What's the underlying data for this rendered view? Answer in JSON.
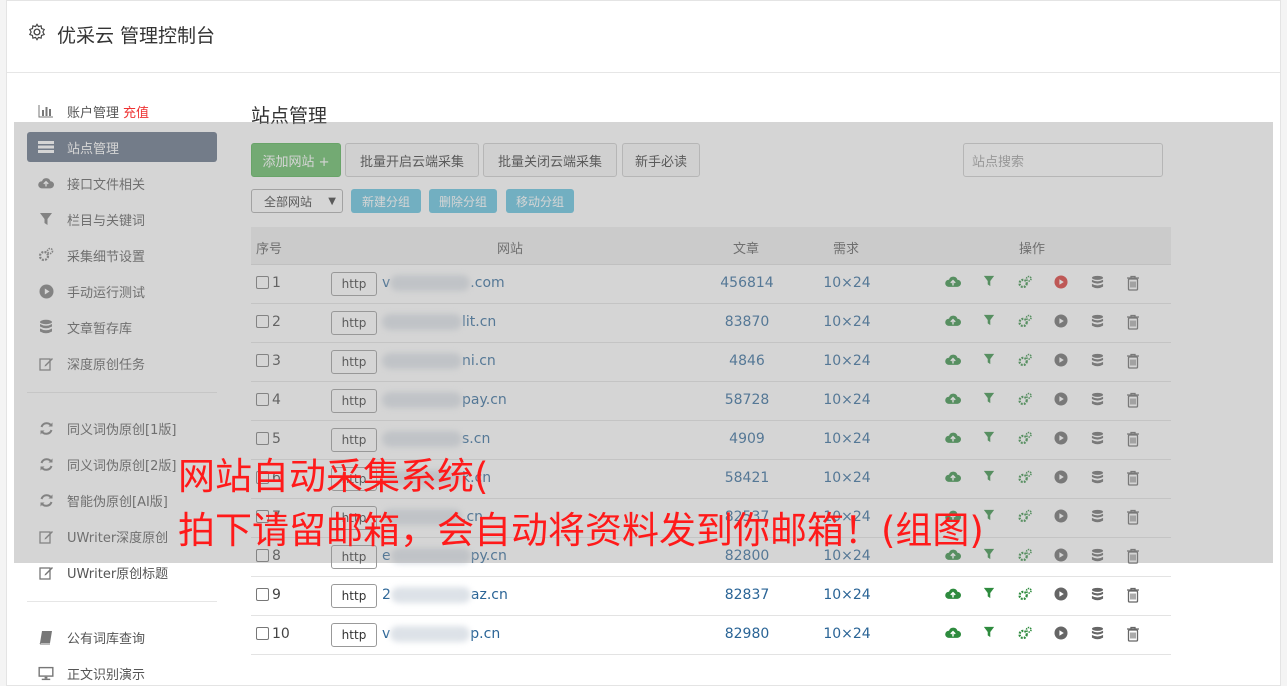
{
  "app": {
    "title": "优采云 管理控制台"
  },
  "sidebar": {
    "group1": [
      {
        "label": "账户管理",
        "tag": "充值",
        "icon": "bar-chart-icon",
        "active": false
      },
      {
        "label": "站点管理",
        "tag": "",
        "icon": "list-icon",
        "active": true
      },
      {
        "label": "接口文件相关",
        "tag": "",
        "icon": "cloud-upload-icon",
        "active": false
      },
      {
        "label": "栏目与关键词",
        "tag": "",
        "icon": "filter-icon",
        "active": false
      },
      {
        "label": "采集细节设置",
        "tag": "",
        "icon": "cogs-icon",
        "active": false
      },
      {
        "label": "手动运行测试",
        "tag": "",
        "icon": "play-circle-icon",
        "active": false
      },
      {
        "label": "文章暂存库",
        "tag": "",
        "icon": "database-icon",
        "active": false
      },
      {
        "label": "深度原创任务",
        "tag": "",
        "icon": "edit-icon",
        "active": false
      }
    ],
    "group2": [
      {
        "label": "同义词伪原创[1版]",
        "icon": "refresh-icon"
      },
      {
        "label": "同义词伪原创[2版]",
        "icon": "refresh-icon"
      },
      {
        "label": "智能伪原创[AI版]",
        "icon": "refresh-icon"
      },
      {
        "label": "UWriter深度原创",
        "icon": "edit-icon"
      },
      {
        "label": "UWriter原创标题",
        "icon": "edit-icon"
      }
    ],
    "group3": [
      {
        "label": "公有词库查询",
        "icon": "book-icon"
      },
      {
        "label": "正文识别演示",
        "icon": "monitor-icon"
      }
    ]
  },
  "main": {
    "title": "站点管理",
    "add_button": "添加网站 +",
    "batch_open": "批量开启云端采集",
    "batch_close": "批量关闭云端采集",
    "guide": "新手必读",
    "search_placeholder": "站点搜索",
    "group_select": "全部网站",
    "new_group": "新建分组",
    "delete_group": "删除分组",
    "move_group": "移动分组"
  },
  "table": {
    "headers": {
      "index": "序号",
      "site": "网站",
      "articles": "文章",
      "need": "需求",
      "ops": "操作"
    },
    "http_label": "http",
    "rows": [
      {
        "num": "1",
        "prefix": "v",
        "suffix": ".com",
        "articles": "456814",
        "need": "10×24",
        "running": true
      },
      {
        "num": "2",
        "prefix": "",
        "suffix": "lit.cn",
        "articles": "83870",
        "need": "10×24",
        "running": false
      },
      {
        "num": "3",
        "prefix": "",
        "suffix": "ni.cn",
        "articles": "4846",
        "need": "10×24",
        "running": false
      },
      {
        "num": "4",
        "prefix": "",
        "suffix": "pay.cn",
        "articles": "58728",
        "need": "10×24",
        "running": false
      },
      {
        "num": "5",
        "prefix": "",
        "suffix": "s.cn",
        "articles": "4909",
        "need": "10×24",
        "running": false
      },
      {
        "num": "6",
        "prefix": "",
        "suffix": "k.cn",
        "articles": "58421",
        "need": "10×24",
        "running": false
      },
      {
        "num": "7",
        "prefix": "",
        "suffix": ".cn",
        "articles": "82537",
        "need": "10×24",
        "running": false
      },
      {
        "num": "8",
        "prefix": "e",
        "suffix": "py.cn",
        "articles": "82800",
        "need": "10×24",
        "running": false
      },
      {
        "num": "9",
        "prefix": "2",
        "suffix": "az.cn",
        "articles": "82837",
        "need": "10×24",
        "running": false
      },
      {
        "num": "10",
        "prefix": "v",
        "suffix": "p.cn",
        "articles": "82980",
        "need": "10×24",
        "running": false
      }
    ]
  },
  "watermark": {
    "line1": "网站自动采集系统(",
    "line2": "拍下请留邮箱，会自动将资料发到你邮箱！(组图)"
  },
  "colors": {
    "accent_green": "#5cb85c",
    "info_blue": "#5bc0de",
    "sidebar_active": "#5d6b80",
    "link_blue": "#2a6496",
    "watermark_red": "#ff1a1a"
  }
}
